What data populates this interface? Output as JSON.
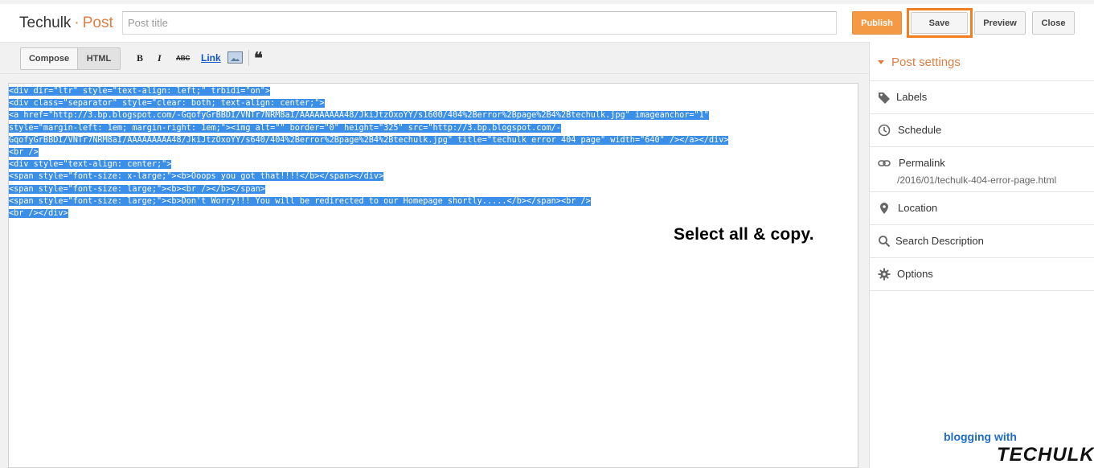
{
  "header": {
    "brand_blog": "Techulk",
    "brand_sep": "·",
    "brand_section": "Post",
    "title_placeholder": "Post title",
    "publish_label": "Publish",
    "save_label": "Save",
    "preview_label": "Preview",
    "close_label": "Close"
  },
  "toolbar": {
    "compose_label": "Compose",
    "html_label": "HTML",
    "active_mode": "HTML",
    "bold_label": "B",
    "italic_label": "I",
    "strike_label": "ABC",
    "link_label": "Link",
    "quote_label": "❝"
  },
  "editor": {
    "selected": true,
    "selection_color": "#3b8fe8",
    "lines": [
      "<div dir=\"ltr\" style=\"text-align: left;\" trbidi=\"on\">",
      "<div class=\"separator\" style=\"clear: both; text-align: center;\">",
      "<a href=\"http://3.bp.blogspot.com/-GqofyGrBBDI/VNTr7NRM8aI/AAAAAAAAA48/JkiJtzOxoYY/s1600/404%2Berror%2Bpage%2B4%2Btechulk.jpg\" imageanchor=\"1\"",
      "style=\"margin-left: 1em; margin-right: 1em;\"><img alt=\"\" border=\"0\" height=\"325\" src=\"http://3.bp.blogspot.com/-",
      "GqofyGrBBDI/VNTr7NRM8aI/AAAAAAAAA48/JkiJtzOxoYY/s640/404%2Berror%2Bpage%2B4%2Btechulk.jpg\" title=\"techulk error 404 page\" width=\"640\" /></a></div>",
      "<br />",
      "<div style=\"text-align: center;\">",
      "<span style=\"font-size: x-large;\"><b>Ooops you got that!!!!</b></span></div>",
      "<span style=\"font-size: large;\"><b><br /></b></span>",
      "<span style=\"font-size: large;\"><b>Don't Worry!!! You will be redirected to our Homepage shortly.....</b></span><br />",
      "<br /></div>"
    ],
    "annotation": "Select all & copy."
  },
  "sidebar": {
    "title": "Post settings",
    "labels": "Labels",
    "schedule": "Schedule",
    "permalink": "Permalink",
    "permalink_value": "/2016/01/techulk-404-error-page.html",
    "location": "Location",
    "search_description": "Search Description",
    "options": "Options"
  },
  "watermark": {
    "line1": "blogging with",
    "line2": "TECHULK"
  },
  "colors": {
    "accent": "#dd7f42",
    "publish": "#f59a44",
    "highlight_box": "#f07f24"
  }
}
